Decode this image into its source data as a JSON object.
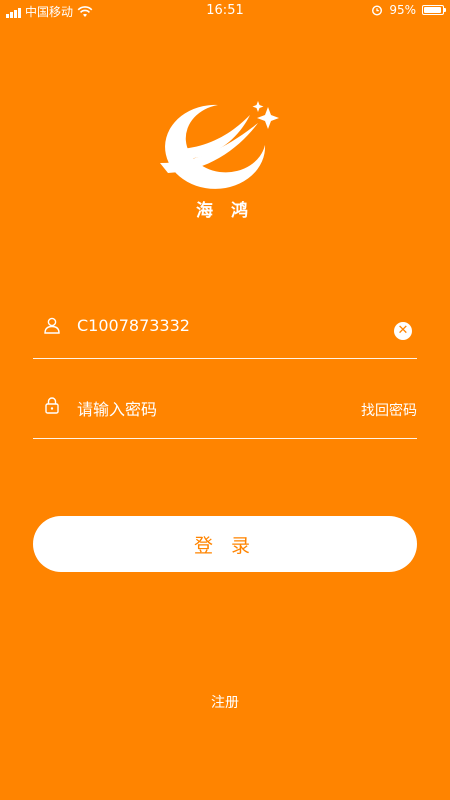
{
  "statusbar": {
    "carrier": "中国移动",
    "time": "16:51",
    "battery_text": "95%",
    "battery_level": 0.95,
    "signal_icon": "signal-icon",
    "wifi_icon": "wifi-icon",
    "alarm_icon": "alarm-icon"
  },
  "brand": {
    "name": "海 鸿"
  },
  "form": {
    "username_value": "C1007873332",
    "password_placeholder": "请输入密码",
    "forgot_label": "找回密码",
    "clear_glyph": "✕"
  },
  "actions": {
    "login_label": "登 录",
    "register_label": "注册"
  },
  "colors": {
    "background": "#FF8400",
    "foreground": "#FFFFFF"
  }
}
